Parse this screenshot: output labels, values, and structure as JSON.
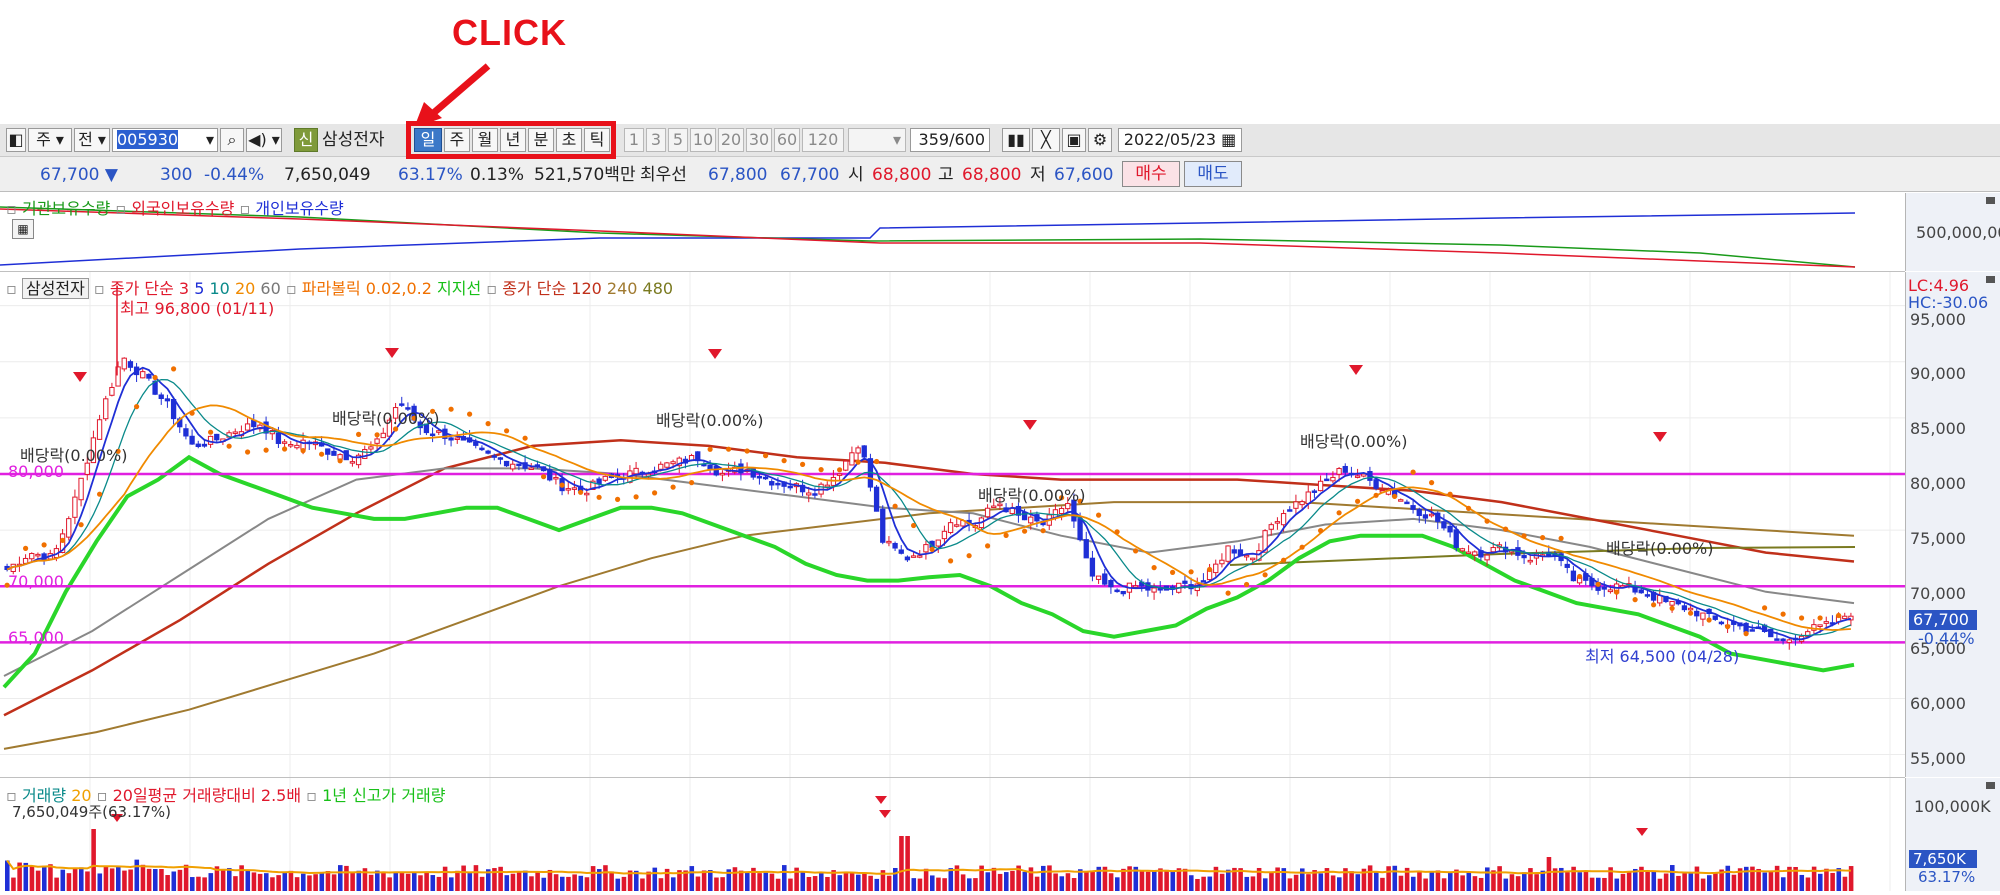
{
  "annotation": {
    "label": "CLICK"
  },
  "toolbar": {
    "period_tab": "주",
    "compare_tab": "전",
    "stock_code": "005930",
    "credit_badge": "신",
    "stock_name": "삼성전자",
    "period_buttons": [
      "일",
      "주",
      "월",
      "년",
      "분",
      "초",
      "틱"
    ],
    "active_period": "일",
    "interval_buttons": [
      "1",
      "3",
      "5",
      "10",
      "20",
      "30",
      "60",
      "120"
    ],
    "count_value": "359",
    "count_total": "/600",
    "date_value": "2022/05/23"
  },
  "quote": {
    "price": "67,700 ▼",
    "change": "300",
    "change_rate": "-0.44%",
    "volume": "7,650,049",
    "volume_rate": "63.17%",
    "turnover_rate": "0.13%",
    "trade_value": "521,570백만",
    "best_quote_label": "최우선",
    "bid_best": "67,800",
    "ask_best": "67,700",
    "open_label": "시",
    "open": "68,800",
    "high_label": "고",
    "high": "68,800",
    "low_label": "저",
    "low": "67,600",
    "buy_button": "매수",
    "sell_button": "매도"
  },
  "holdings_panel": {
    "legend": [
      "기관보유수량",
      "외국인보유수량",
      "개인보유수량"
    ],
    "legend_colors": [
      "#1a9a1a",
      "#e0182c",
      "#1f2fd6"
    ],
    "axis_label": "500,000,00"
  },
  "price_panel": {
    "legend_stock": "삼성전자",
    "legend_ma_label": "종가 단순",
    "legend_ma_periods": [
      "3",
      "5",
      "10",
      "20",
      "60"
    ],
    "legend_parabolic": "파라볼릭 0.02,0.2",
    "legend_support": "지지선",
    "legend_ma2_label": "종가 단순",
    "legend_ma2_periods": [
      "120",
      "240",
      "480"
    ],
    "high_marker": "최고 96,800 (01/11)",
    "low_marker": "최저 64,500 (04/28)",
    "dividend_labels": [
      "배당락(0.00%)",
      "배당락(0.00%)",
      "배당락(0.00%)",
      "배당락(0.00%)",
      "배당락(0.00%)",
      "배당락(0.00%)"
    ],
    "hline_labels": [
      "80,000",
      "70,000",
      "65,000"
    ],
    "lc_label": "LC:4.96",
    "hc_label": "HC:-30.06",
    "y_ticks": [
      "95,000",
      "90,000",
      "85,000",
      "80,000",
      "75,000",
      "70,000",
      "65,000",
      "60,000",
      "55,000"
    ],
    "current_price": "67,700",
    "current_change": "-0.44%"
  },
  "volume_panel": {
    "legend_volume": "거래량",
    "legend_period": "20",
    "legend_ratio": "20일평균 거래량대비 2.5배",
    "legend_newhigh": "1년 신고가 거래량",
    "last_volume": "7,650,049주(63.17%)",
    "y_tick": "100,000K",
    "current_volume": "7,650K",
    "current_rate": "63.17%"
  },
  "chart_data": {
    "type": "candlestick",
    "title": "삼성전자",
    "ylim": [
      53000,
      98000
    ],
    "horizontal_lines": [
      80000,
      70000,
      65000
    ],
    "high": 96800,
    "low": 64500,
    "last_close": 67700,
    "price_path": [
      71500,
      73000,
      72500,
      78000,
      85000,
      90500,
      88500,
      86000,
      82500,
      83000,
      84000,
      84500,
      82500,
      83000,
      82000,
      81500,
      82500,
      86500,
      84000,
      83500,
      82500,
      81500,
      81000,
      80500,
      79000,
      78500,
      79500,
      80000,
      80500,
      81000,
      81500,
      80000,
      80500,
      79500,
      79000,
      78500,
      80000,
      83000,
      74000,
      72500,
      73500,
      76000,
      75500,
      77500,
      76000,
      75500,
      77500,
      71000,
      69500,
      70000,
      69500,
      70000,
      70500,
      73500,
      72500,
      76000,
      77500,
      79000,
      80500,
      79500,
      78500,
      77000,
      76000,
      73500,
      73000,
      73500,
      72500,
      73000,
      70500,
      70000,
      70000,
      69500,
      68500,
      68000,
      67000,
      66500,
      66000,
      65000,
      66000,
      66500,
      67700
    ],
    "ma_support": [
      61000,
      64000,
      69500,
      74000,
      78000,
      79500,
      81500,
      80000,
      79000,
      78000,
      77000,
      76500,
      76000,
      76000,
      76500,
      77000,
      77000,
      76000,
      75000,
      76000,
      77000,
      77000,
      76500,
      75500,
      74500,
      73500,
      72000,
      71000,
      70500,
      70500,
      70800,
      71000,
      70000,
      68500,
      67500,
      66000,
      65500,
      66000,
      66500,
      68000,
      69000,
      70500,
      72500,
      74000,
      74500,
      74500,
      74500,
      73500,
      72000,
      70500,
      69500,
      68500,
      68000,
      67500,
      66500,
      65500,
      64000,
      63500,
      63000,
      62500,
      63000
    ]
  }
}
